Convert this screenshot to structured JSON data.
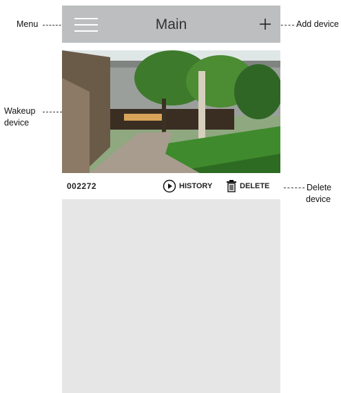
{
  "app": {
    "title": "Main"
  },
  "device": {
    "id": "002272"
  },
  "actions": {
    "history_label": "HISTORY",
    "delete_label": "DELETE"
  },
  "icons": {
    "menu": "hamburger-menu-icon",
    "add": "plus-icon",
    "history": "play-circle-icon",
    "delete": "trash-icon"
  },
  "callouts": {
    "menu": "Menu",
    "add_device": "Add device",
    "wakeup": [
      "Wakeup",
      "device"
    ],
    "delete_device": [
      "Delete",
      "device"
    ]
  }
}
